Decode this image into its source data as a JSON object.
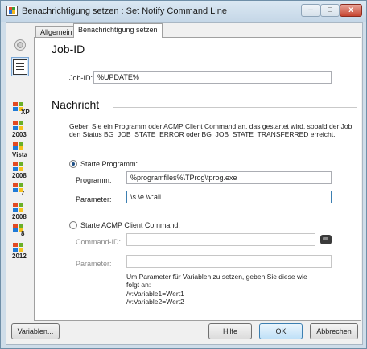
{
  "window": {
    "title": "Benachrichtigung setzen : Set Notify Command Line",
    "minimize_label": "–",
    "maximize_label": "□",
    "close_label": "x"
  },
  "sidebar": {
    "items": [
      {
        "label": "XP"
      },
      {
        "label": "2003"
      },
      {
        "label": "Vista"
      },
      {
        "label": "2008"
      },
      {
        "label": "7"
      },
      {
        "label": "2008"
      },
      {
        "label": "8"
      },
      {
        "label": "2012"
      }
    ]
  },
  "tabs": [
    {
      "label": "Allgemein"
    },
    {
      "label": "Benachrichtigung setzen"
    }
  ],
  "jobid_section": {
    "title": "Job-ID",
    "field_label": "Job-ID:",
    "field_value": "%UPDATE%"
  },
  "message_section": {
    "title": "Nachricht",
    "description": "Geben Sie ein Programm oder ACMP Client Command an, das gestartet wird, sobald der Job den Status BG_JOB_STATE_ERROR oder BG_JOB_STATE_TRANSFERRED erreicht.",
    "radio_program": "Starte Programm:",
    "program_label": "Programm:",
    "program_value": "%programfiles%\\TProg\\tprog.exe",
    "parameter_label": "Parameter:",
    "parameter_value": "\\s \\e \\v:all",
    "radio_acmp": "Starte ACMP Client Command:",
    "command_id_label": "Command-ID:",
    "command_id_value": "",
    "acmp_parameter_label": "Parameter:",
    "acmp_parameter_value": "",
    "hint_line1": "Um Parameter für Variablen zu setzen, geben Sie diese wie",
    "hint_line2": "folgt an:",
    "hint_line3": "/v:Variable1=Wert1",
    "hint_line4": "/v:Variable2=Wert2"
  },
  "buttons": {
    "variables": "Variablen...",
    "help": "Hilfe",
    "ok": "OK",
    "cancel": "Abbrechen"
  }
}
